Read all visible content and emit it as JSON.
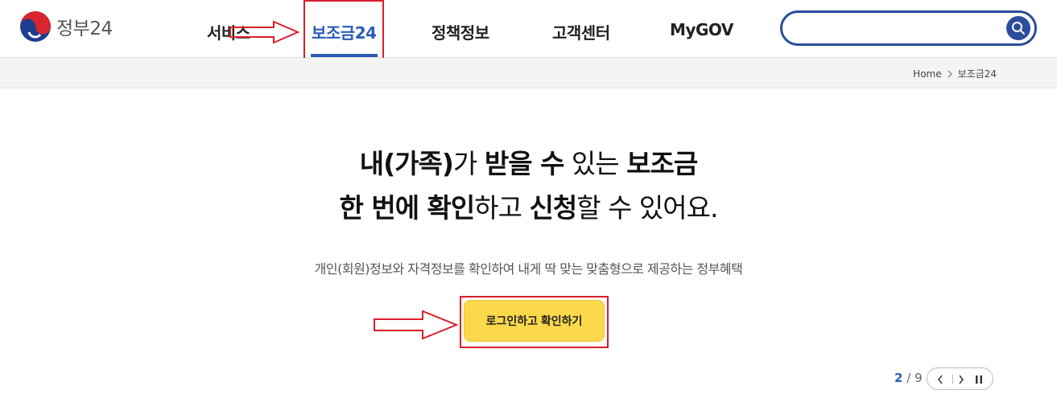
{
  "header": {
    "logo_text": "정부24",
    "nav": [
      {
        "label": "서비스"
      },
      {
        "label": "보조금24"
      },
      {
        "label": "정책정보"
      },
      {
        "label": "고객센터"
      },
      {
        "label": "MyGOV"
      }
    ],
    "search": {
      "placeholder": "",
      "value": ""
    }
  },
  "breadcrumb": {
    "home": "Home",
    "current": "보조금24"
  },
  "hero": {
    "line1": {
      "a": "내(가족)",
      "b": "가 ",
      "c": "받을 수",
      "d": " 있는 ",
      "e": "보조금"
    },
    "line2": {
      "a": "한 번에 확인",
      "b": "하고 ",
      "c": "신청",
      "d": "할 수 있어요."
    },
    "description": "개인(회원)정보와 자격정보를 확인하여 내게 딱 맞는 맞춤형으로 제공하는 정부혜택",
    "cta_label": "로그인하고 확인하기"
  },
  "pager": {
    "current": "2",
    "separator": "/",
    "total": "9"
  },
  "colors": {
    "brand_blue": "#2a5db8",
    "search_border": "#2a4d9c",
    "cta_yellow": "#fcd94a",
    "annotation_red": "#d9202a"
  },
  "icons": [
    "gov-logo-icon",
    "search-icon",
    "chevron-right-icon",
    "chevron-left-icon",
    "pause-icon",
    "red-arrow-icon"
  ]
}
